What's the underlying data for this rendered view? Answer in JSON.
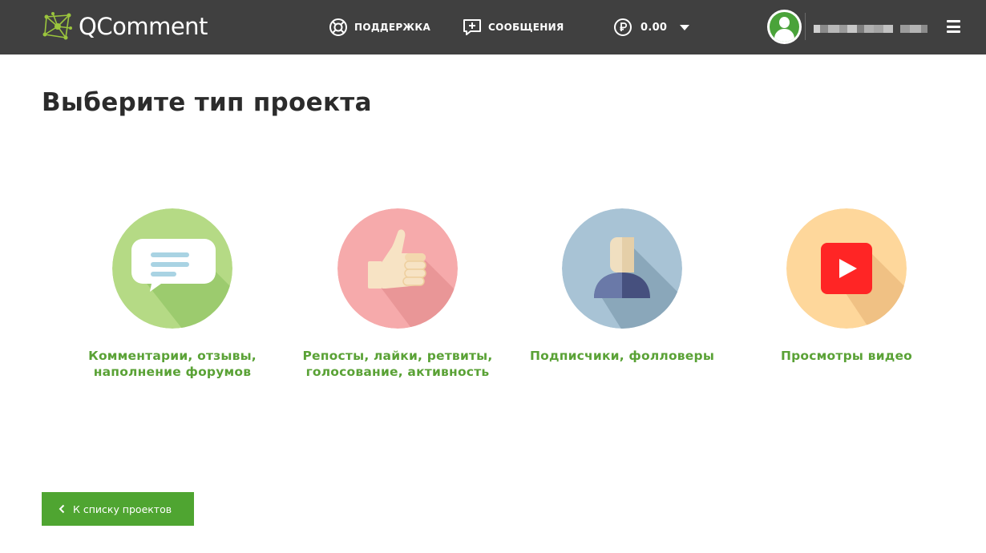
{
  "header": {
    "logo_text": "QComment",
    "nav": {
      "support": "ПОДДЕРЖКА",
      "messages": "СООБЩЕНИЯ"
    },
    "balance": {
      "currency_icon": "ruble-icon",
      "amount": "0.00"
    },
    "user": {
      "avatar_icon": "user-avatar-icon",
      "menu_icon": "hamburger-menu-icon"
    }
  },
  "main": {
    "title": "Выберите тип проекта",
    "cards": [
      {
        "label": "Комментарии, отзывы, наполнение форумов",
        "icon": "speech-bubble-icon",
        "color": "#b5da85"
      },
      {
        "label": "Репосты, лайки, ретвиты, голосование, активность",
        "icon": "thumbs-up-icon",
        "color": "#f6aaab"
      },
      {
        "label": "Подписчики, фолловеры",
        "icon": "person-icon",
        "color": "#a8c3d5"
      },
      {
        "label": "Просмотры видео",
        "icon": "play-video-icon",
        "color": "#fed79b"
      }
    ],
    "back_button": "К списку проектов"
  },
  "colors": {
    "header_bg": "#404040",
    "accent_green": "#4fa531",
    "label_green": "#5aa236"
  }
}
